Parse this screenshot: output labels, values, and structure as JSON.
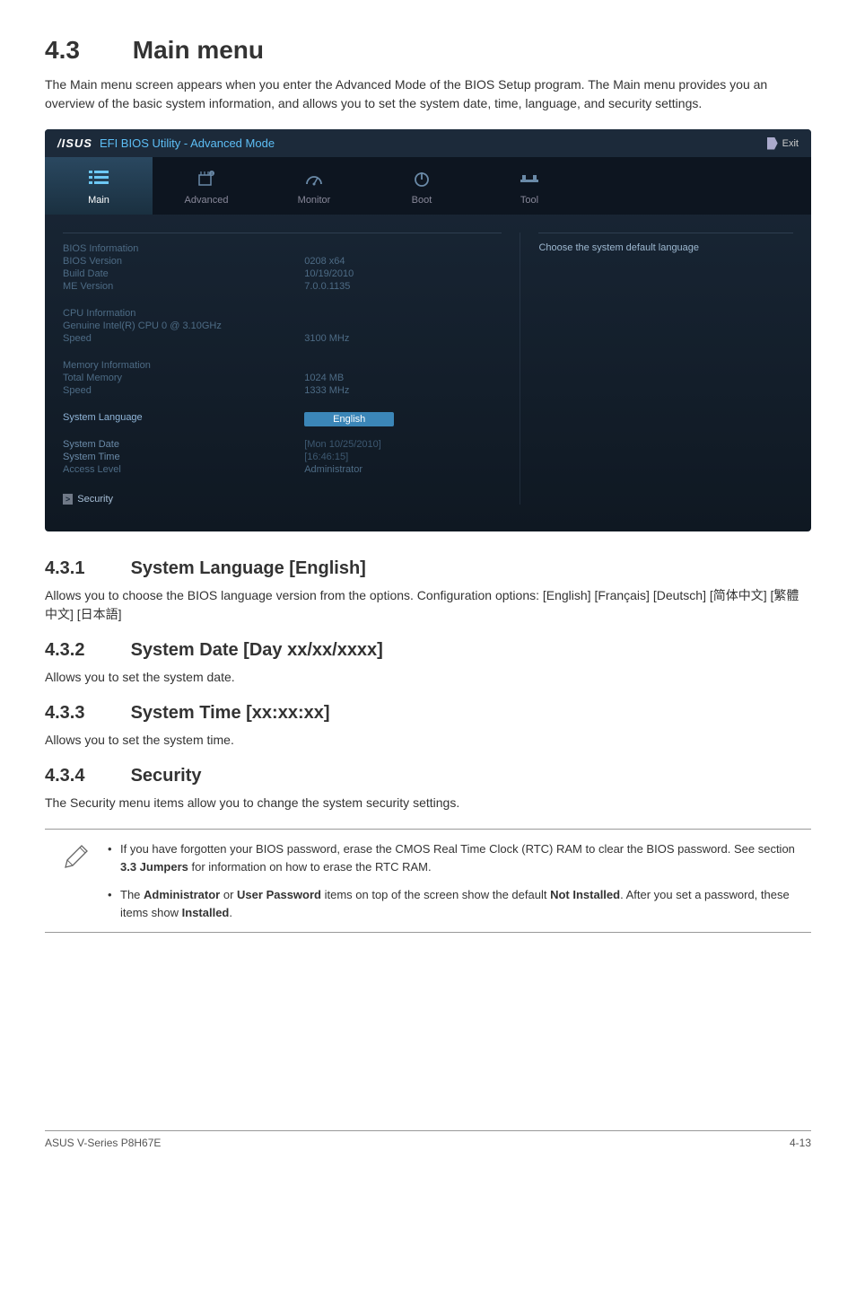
{
  "page": {
    "section_number": "4.3",
    "section_title": "Main menu",
    "intro": "The Main menu screen appears when you enter the Advanced Mode of the BIOS Setup program. The Main menu provides you an overview of the basic system information, and allows you to set the system date, time, language, and security settings."
  },
  "bios": {
    "brand": "/ISUS",
    "utility": "EFI BIOS Utility - Advanced Mode",
    "exit": "Exit",
    "tabs": {
      "main": "Main",
      "advanced": "Advanced",
      "monitor": "Monitor",
      "boot": "Boot",
      "tool": "Tool"
    },
    "help_text": "Choose the system default language",
    "info": {
      "bios_info_hdr": "BIOS Information",
      "bios_version_l": "BIOS Version",
      "bios_version_v": "0208 x64",
      "build_date_l": "Build Date",
      "build_date_v": "10/19/2010",
      "me_version_l": "ME Version",
      "me_version_v": "7.0.0.1135",
      "cpu_info_hdr": "CPU Information",
      "cpu_model": "Genuine Intel(R) CPU 0 @ 3.10GHz",
      "cpu_speed_l": "Speed",
      "cpu_speed_v": "3100 MHz",
      "mem_info_hdr": "Memory Information",
      "total_mem_l": "Total Memory",
      "total_mem_v": "1024 MB",
      "mem_speed_l": "Speed",
      "mem_speed_v": "1333 MHz",
      "sys_lang_l": "System Language",
      "sys_lang_v": "English",
      "sys_date_l": "System Date",
      "sys_date_v": "[Mon 10/25/2010]",
      "sys_time_l": "System Time",
      "sys_time_v": "[16:46:15]",
      "access_l": "Access Level",
      "access_v": "Administrator",
      "security": "Security"
    }
  },
  "subs": {
    "s431_num": "4.3.1",
    "s431_title": "System Language [English]",
    "s431_text": "Allows you to choose the BIOS language version from the options. Configuration options: [English] [Français] [Deutsch] [简体中文] [繁體中文] [日本語]",
    "s432_num": "4.3.2",
    "s432_title": "System Date [Day xx/xx/xxxx]",
    "s432_text": "Allows you to set the system date.",
    "s433_num": "4.3.3",
    "s433_title": "System Time [xx:xx:xx]",
    "s433_text": "Allows you to set the system time.",
    "s434_num": "4.3.4",
    "s434_title": "Security",
    "s434_text": "The Security menu items allow you to change the system security settings."
  },
  "notes": {
    "n1_pre": "If you have forgotten your BIOS password, erase the CMOS Real Time Clock (RTC) RAM to clear the BIOS password. See section ",
    "n1_bold": "3.3 Jumpers",
    "n1_post": " for information on how to erase the RTC RAM.",
    "n2_a": "The ",
    "n2_b": "Administrator",
    "n2_c": " or ",
    "n2_d": "User Password",
    "n2_e": " items on top of the screen show the default ",
    "n2_f": "Not Installed",
    "n2_g": ". After you set a password, these items show ",
    "n2_h": "Installed",
    "n2_i": "."
  },
  "footer": {
    "left": "ASUS V-Series P8H67E",
    "right": "4-13"
  }
}
